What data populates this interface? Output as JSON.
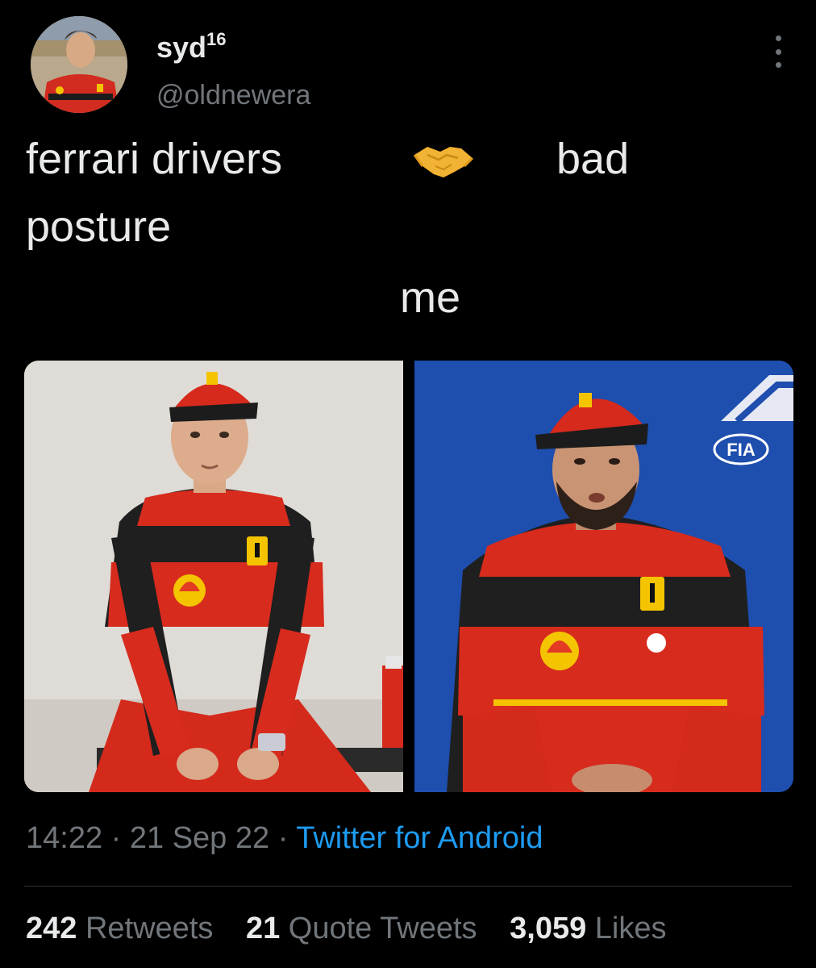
{
  "user": {
    "display_name": "syd",
    "display_name_suffix": "16",
    "handle": "@oldnewera"
  },
  "tweet": {
    "line1_left": "ferrari drivers",
    "line1_right": "bad",
    "emoji": "handshake-emoji",
    "line2": "posture",
    "line3": "me"
  },
  "media": {
    "left_image": "ferrari-driver-seated-photo",
    "right_image": "ferrari-driver-press-conference-photo",
    "right_logo_text": "FIA"
  },
  "meta": {
    "time": "14:22",
    "separator1": " · ",
    "date": "21 Sep 22",
    "separator2": " · ",
    "source": "Twitter for Android"
  },
  "stats": {
    "retweets_count": "242",
    "retweets_label": "Retweets",
    "quotes_count": "21",
    "quotes_label": "Quote Tweets",
    "likes_count": "3,059",
    "likes_label": "Likes"
  },
  "colors": {
    "background": "#000000",
    "text": "#e7e9ea",
    "muted": "#71767b",
    "link": "#1d9bf0",
    "ferrari_red": "#d8231c"
  }
}
